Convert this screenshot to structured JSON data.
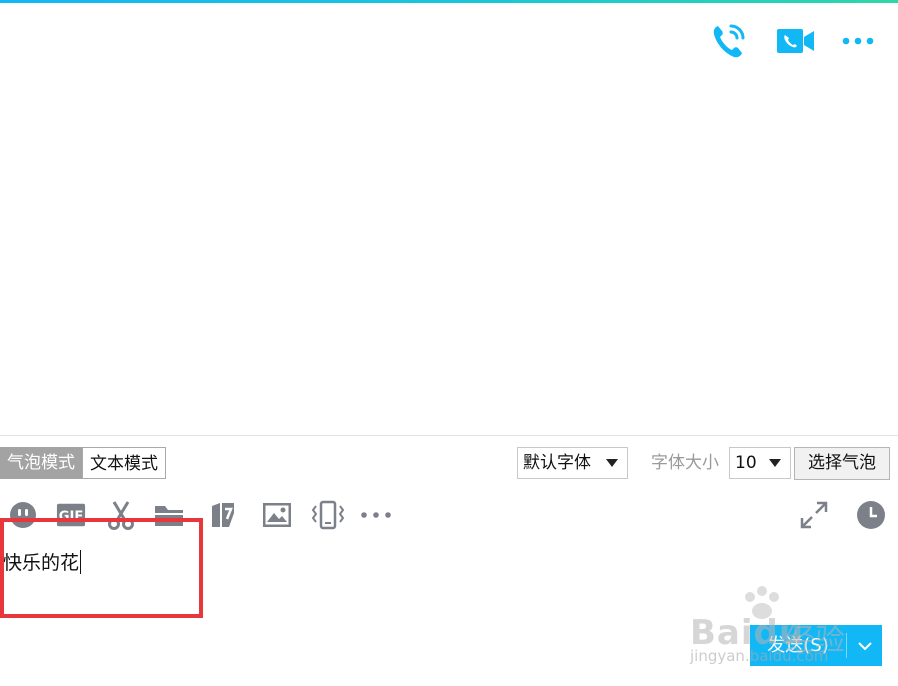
{
  "header": {
    "icons": [
      "voice-call-icon",
      "video-call-icon",
      "more-icon"
    ],
    "accent_color": "#12b7f5"
  },
  "toolbar": {
    "bubble_mode_label": "气泡模式",
    "text_mode_label": "文本模式",
    "font_family_value": "默认字体",
    "font_size_label": "字体大小",
    "font_size_value": "10",
    "choose_bubble_label": "选择气泡"
  },
  "tools": [
    "emoji-icon",
    "gif-icon",
    "screenshot-scissors-icon",
    "folder-icon",
    "clipboard-icon",
    "image-icon",
    "shake-window-icon",
    "more-tools-icon",
    "expand-icon",
    "history-clock-icon"
  ],
  "input": {
    "text": "快乐的花"
  },
  "send": {
    "label": "发送(S)"
  },
  "watermark": {
    "brand": "Baidu",
    "brand_cn": "经验",
    "url": "jingyan.baidu.com"
  },
  "colors": {
    "highlight": "#e8373c",
    "mode_active_bg": "#a3a3a3"
  }
}
